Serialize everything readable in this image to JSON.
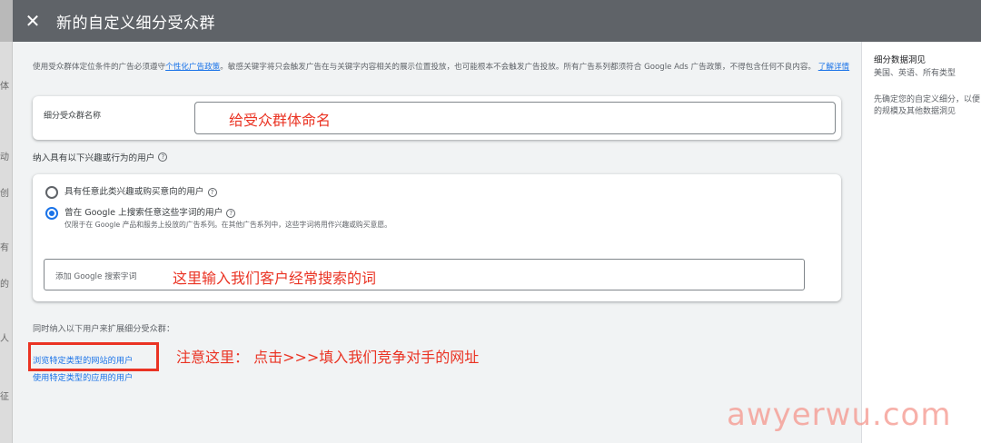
{
  "header": {
    "title": "新的自定义细分受众群",
    "close_icon": "close-icon"
  },
  "background_sidebar": [
    "体",
    "动",
    "创",
    "有",
    "的",
    "人",
    "征"
  ],
  "intro": {
    "text_before_link": "使用受众群体定位条件的广告必须遵守",
    "policy_link": "个性化广告政策",
    "text_after_link": "。敏感关键字将只会触发广告在与关键字内容相关的展示位置投放，也可能根本不会触发广告投放。所有广告系列都须符合 Google Ads 广告政策，不得包含任何不良内容。",
    "learn_more": "了解详情"
  },
  "segment_name": {
    "label": "细分受众群名称",
    "value": ""
  },
  "include": {
    "label": "纳入具有以下兴趣或行为的用户",
    "options": [
      {
        "label": "具有任意此类兴趣或购买意向的用户",
        "selected": false
      },
      {
        "label": "曾在 Google 上搜索任意这些字词的用户",
        "sub": "仅限于在 Google 产品和服务上投放的广告系列。在其他广告系列中，这些字词将用作兴趣或购买意愿。",
        "selected": true
      }
    ],
    "search_placeholder": "添加 Google 搜索字词"
  },
  "expand": {
    "label": "同时纳入以下用户来扩展细分受众群：",
    "link_websites": "浏览特定类型的网站的用户",
    "link_apps": "使用特定类型的应用的用户"
  },
  "annotations": {
    "name_hint": "给受众群体命名",
    "search_hint": "这里输入我们客户经常搜索的词",
    "website_hint": "注意这里：  点击>>>填入我们竞争对手的网址"
  },
  "right_panel": {
    "title": "细分数据洞见",
    "subtitle": "美国、英语、所有类型",
    "description_line1": "先确定您的自定义细分，以便",
    "description_line2": "的规模及其他数据洞见"
  },
  "watermark": "awyerwu.com",
  "colors": {
    "accent": "#1a73e8",
    "annotation": "#ea3323",
    "header": "#5f6368"
  }
}
